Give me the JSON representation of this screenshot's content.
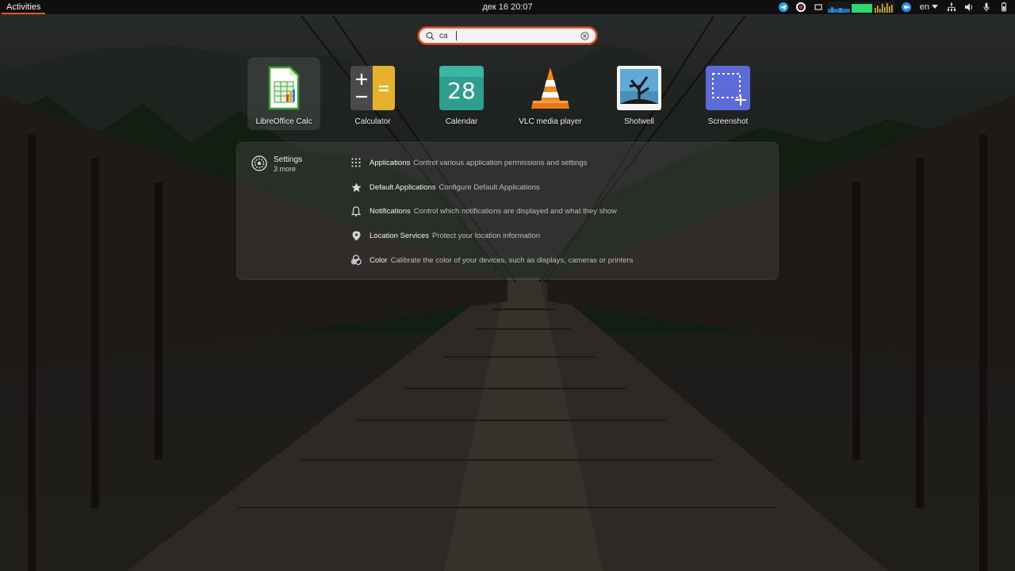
{
  "topbar": {
    "activities": "Activities",
    "clock": "дек 16  20:07",
    "language": "en",
    "tray_icons": [
      "telegram-icon",
      "opera-icon",
      "screen-icon",
      "network-graph-icon",
      "cpu-graph-icon",
      "zoom-icon",
      "network-icon",
      "volume-icon",
      "microphone-icon",
      "battery-icon"
    ]
  },
  "search": {
    "query": "ca",
    "icon": "search-icon",
    "clear_icon": "clear-icon"
  },
  "apps": [
    {
      "label": "LibreOffice Calc",
      "icon": "libreoffice-calc-icon"
    },
    {
      "label": "Calculator",
      "icon": "calculator-icon"
    },
    {
      "label": "Calendar",
      "icon": "calendar-icon",
      "day": "28"
    },
    {
      "label": "VLC media player",
      "icon": "vlc-icon"
    },
    {
      "label": "Shotwell",
      "icon": "shotwell-icon"
    },
    {
      "label": "Screenshot",
      "icon": "screenshot-icon"
    }
  ],
  "results": {
    "provider": {
      "name": "Settings",
      "more": "3 more",
      "icon": "settings-gear-icon"
    },
    "items": [
      {
        "title": "Applications",
        "description": "Control various application permissions and settings",
        "icon": "grid-icon"
      },
      {
        "title": "Default Applications",
        "description": "Configure Default Applications",
        "icon": "star-icon"
      },
      {
        "title": "Notifications",
        "description": "Control which notifications are displayed and what they show",
        "icon": "bell-icon"
      },
      {
        "title": "Location Services",
        "description": "Protect your location information",
        "icon": "location-pin-icon"
      },
      {
        "title": "Color",
        "description": "Calibrate the color of your devices, such as displays, cameras or printers",
        "icon": "color-icon"
      }
    ]
  },
  "colors": {
    "accent": "#e95420",
    "topbar": "#0f0f0f"
  }
}
